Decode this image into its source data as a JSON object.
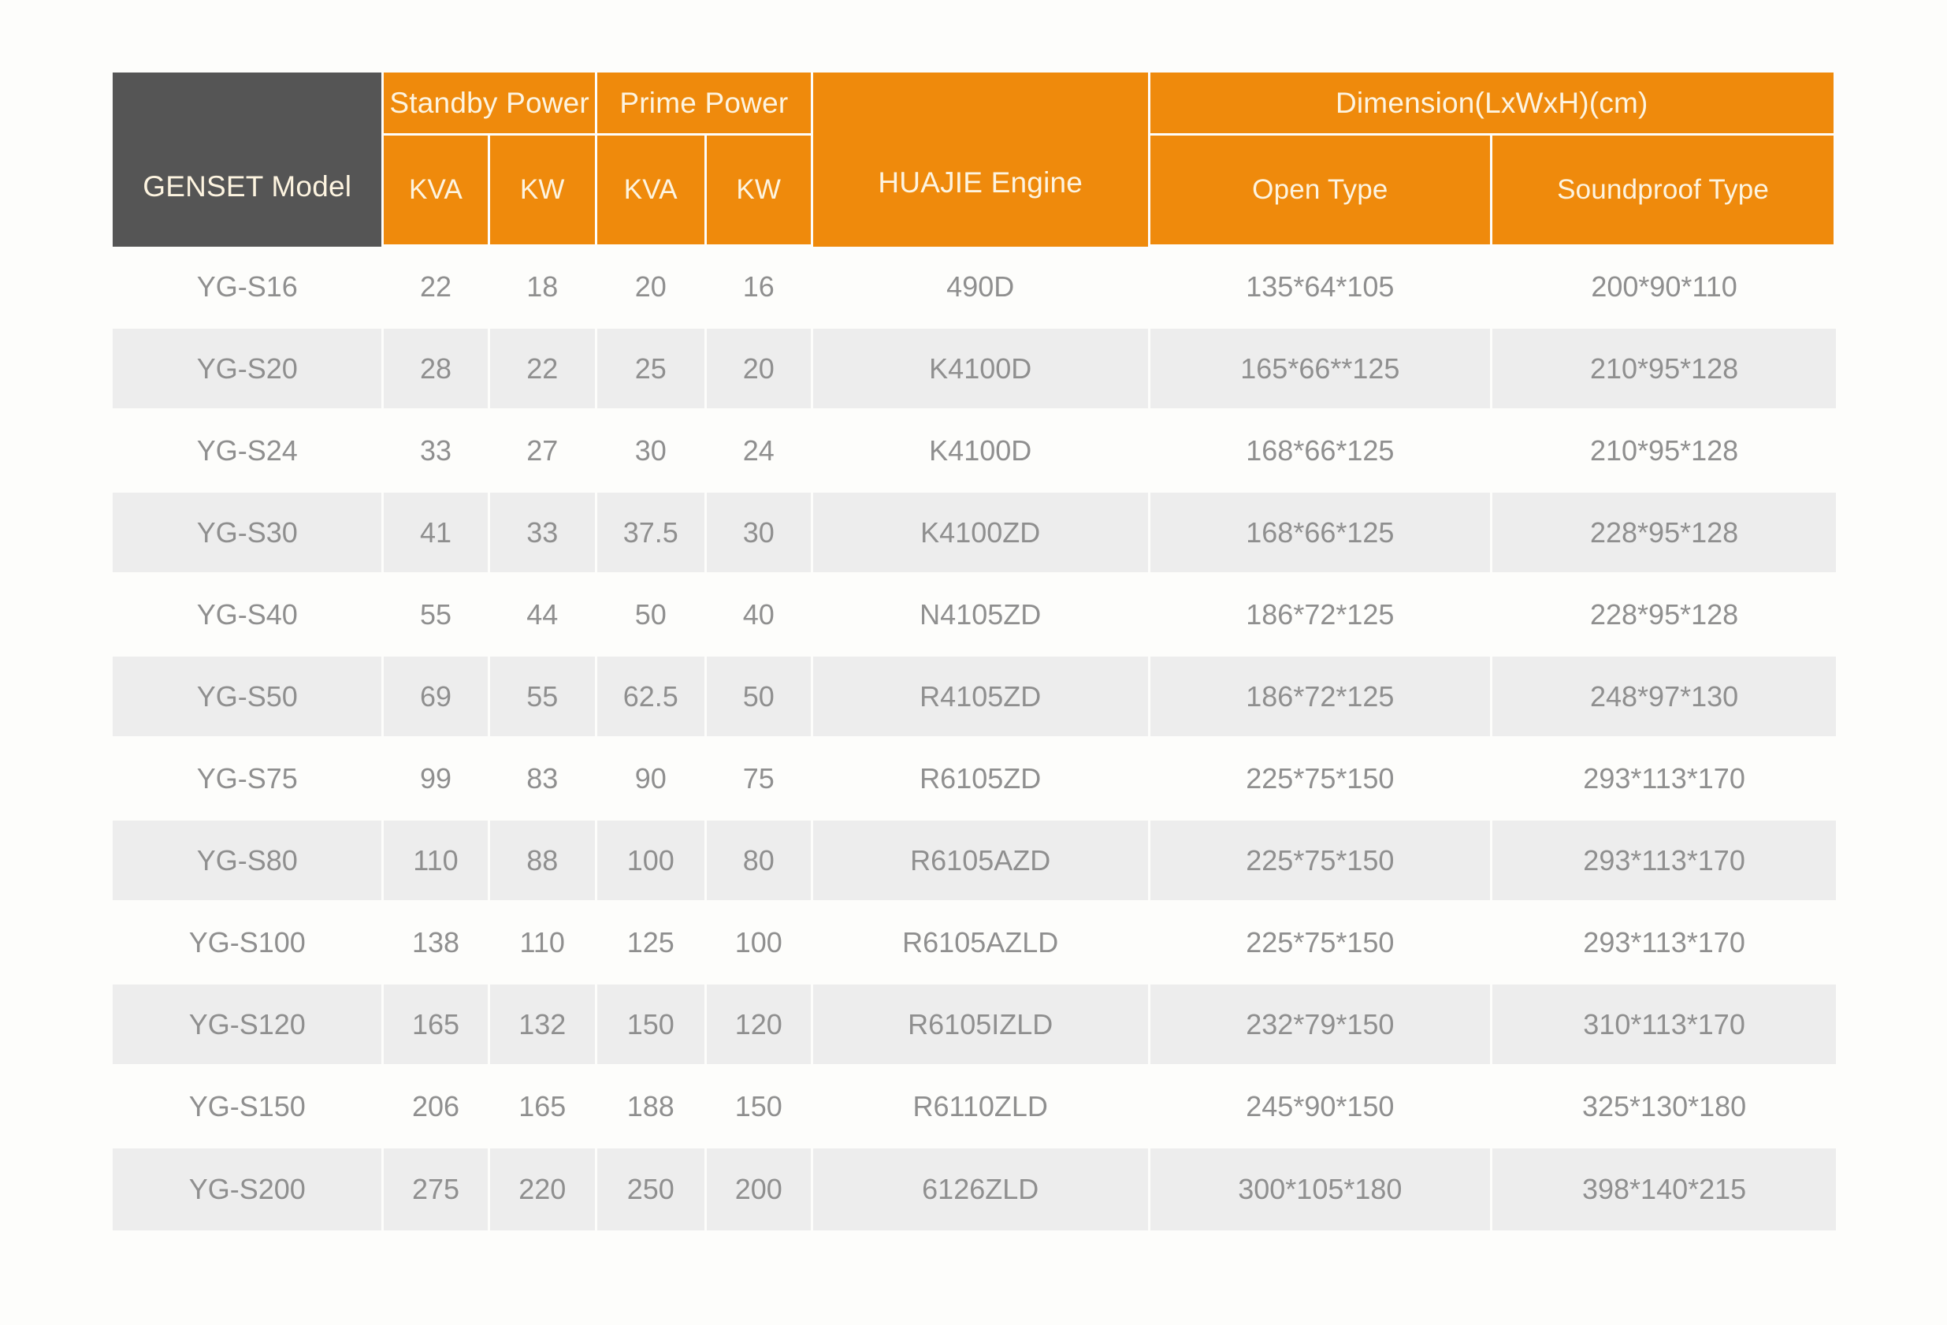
{
  "table": {
    "header": {
      "model_label": "GENSET Model",
      "standby_group": "Standby Power",
      "prime_group": "Prime Power",
      "engine_label": "HUAJIE  Engine",
      "dimension_group": "Dimension(LxWxH)(cm)",
      "standby_kva": "KVA",
      "standby_kw": "KW",
      "prime_kva": "KVA",
      "prime_kw": "KW",
      "open_type": "Open Type",
      "soundproof_type": "Soundproof Type"
    },
    "columns": [
      "GENSET Model",
      "Standby Power KVA",
      "Standby Power KW",
      "Prime Power KVA",
      "Prime Power KW",
      "HUAJIE  Engine",
      "Dimension Open Type",
      "Dimension Soundproof Type"
    ],
    "rows": [
      {
        "model": "YG-S16",
        "standby_kva": "22",
        "standby_kw": "18",
        "prime_kva": "20",
        "prime_kw": "16",
        "engine": "490D",
        "open_type": "135*64*105",
        "soundproof_type": "200*90*110"
      },
      {
        "model": "YG-S20",
        "standby_kva": "28",
        "standby_kw": "22",
        "prime_kva": "25",
        "prime_kw": "20",
        "engine": "K4100D",
        "open_type": "165*66**125",
        "soundproof_type": "210*95*128"
      },
      {
        "model": "YG-S24",
        "standby_kva": "33",
        "standby_kw": "27",
        "prime_kva": "30",
        "prime_kw": "24",
        "engine": "K4100D",
        "open_type": "168*66*125",
        "soundproof_type": "210*95*128"
      },
      {
        "model": "YG-S30",
        "standby_kva": "41",
        "standby_kw": "33",
        "prime_kva": "37.5",
        "prime_kw": "30",
        "engine": "K4100ZD",
        "open_type": "168*66*125",
        "soundproof_type": "228*95*128"
      },
      {
        "model": "YG-S40",
        "standby_kva": "55",
        "standby_kw": "44",
        "prime_kva": "50",
        "prime_kw": "40",
        "engine": "N4105ZD",
        "open_type": "186*72*125",
        "soundproof_type": "228*95*128"
      },
      {
        "model": "YG-S50",
        "standby_kva": "69",
        "standby_kw": "55",
        "prime_kva": "62.5",
        "prime_kw": "50",
        "engine": "R4105ZD",
        "open_type": "186*72*125",
        "soundproof_type": "248*97*130"
      },
      {
        "model": "YG-S75",
        "standby_kva": "99",
        "standby_kw": "83",
        "prime_kva": "90",
        "prime_kw": "75",
        "engine": "R6105ZD",
        "open_type": "225*75*150",
        "soundproof_type": "293*113*170"
      },
      {
        "model": "YG-S80",
        "standby_kva": "110",
        "standby_kw": "88",
        "prime_kva": "100",
        "prime_kw": "80",
        "engine": "R6105AZD",
        "open_type": "225*75*150",
        "soundproof_type": "293*113*170"
      },
      {
        "model": "YG-S100",
        "standby_kva": "138",
        "standby_kw": "110",
        "prime_kva": "125",
        "prime_kw": "100",
        "engine": "R6105AZLD",
        "open_type": "225*75*150",
        "soundproof_type": "293*113*170"
      },
      {
        "model": "YG-S120",
        "standby_kva": "165",
        "standby_kw": "132",
        "prime_kva": "150",
        "prime_kw": "120",
        "engine": "R6105IZLD",
        "open_type": "232*79*150",
        "soundproof_type": "310*113*170"
      },
      {
        "model": "YG-S150",
        "standby_kva": "206",
        "standby_kw": "165",
        "prime_kva": "188",
        "prime_kw": "150",
        "engine": "R6110ZLD",
        "open_type": "245*90*150",
        "soundproof_type": "325*130*180"
      },
      {
        "model": "YG-S200",
        "standby_kva": "275",
        "standby_kw": "220",
        "prime_kva": "250",
        "prime_kw": "200",
        "engine": "6126ZLD",
        "open_type": "300*105*180",
        "soundproof_type": "398*140*215"
      }
    ]
  },
  "colors": {
    "header_orange": "#ef8a0c",
    "header_dark": "#555555",
    "header_text": "#fdf4e0",
    "body_text": "#8f8f8f",
    "row_alt": "#ededed",
    "page_background": "#fdfdfb"
  }
}
